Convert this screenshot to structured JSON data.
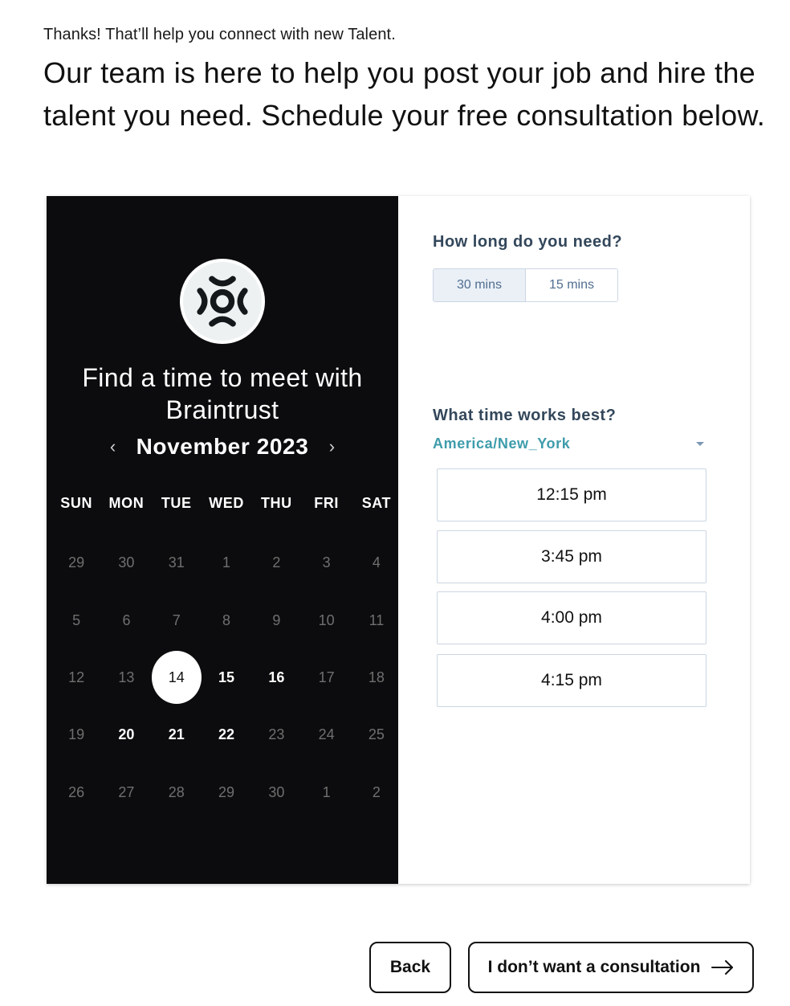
{
  "intro": {
    "small": "Thanks! That’ll help you connect with new Talent.",
    "large": "Our team is here to help you post your job and hire the talent you need. Schedule your free consultation below."
  },
  "calendar": {
    "title": "Find a time to meet with Braintrust",
    "month": "November 2023",
    "prev_icon": "chevron-left-icon",
    "next_icon": "chevron-right-icon",
    "weekdays": [
      "SUN",
      "MON",
      "TUE",
      "WED",
      "THU",
      "FRI",
      "SAT"
    ],
    "days": [
      {
        "label": "29",
        "state": "disabled"
      },
      {
        "label": "30",
        "state": "disabled"
      },
      {
        "label": "31",
        "state": "disabled"
      },
      {
        "label": "1",
        "state": "disabled"
      },
      {
        "label": "2",
        "state": "disabled"
      },
      {
        "label": "3",
        "state": "disabled"
      },
      {
        "label": "4",
        "state": "disabled"
      },
      {
        "label": "5",
        "state": "disabled"
      },
      {
        "label": "6",
        "state": "disabled"
      },
      {
        "label": "7",
        "state": "disabled"
      },
      {
        "label": "8",
        "state": "disabled"
      },
      {
        "label": "9",
        "state": "disabled"
      },
      {
        "label": "10",
        "state": "disabled"
      },
      {
        "label": "11",
        "state": "disabled"
      },
      {
        "label": "12",
        "state": "disabled"
      },
      {
        "label": "13",
        "state": "disabled"
      },
      {
        "label": "14",
        "state": "selected"
      },
      {
        "label": "15",
        "state": "available"
      },
      {
        "label": "16",
        "state": "available"
      },
      {
        "label": "17",
        "state": "disabled"
      },
      {
        "label": "18",
        "state": "disabled"
      },
      {
        "label": "19",
        "state": "disabled"
      },
      {
        "label": "20",
        "state": "available"
      },
      {
        "label": "21",
        "state": "available"
      },
      {
        "label": "22",
        "state": "available"
      },
      {
        "label": "23",
        "state": "disabled"
      },
      {
        "label": "24",
        "state": "disabled"
      },
      {
        "label": "25",
        "state": "disabled"
      },
      {
        "label": "26",
        "state": "disabled"
      },
      {
        "label": "27",
        "state": "disabled"
      },
      {
        "label": "28",
        "state": "disabled"
      },
      {
        "label": "29",
        "state": "disabled"
      },
      {
        "label": "30",
        "state": "disabled"
      },
      {
        "label": "1",
        "state": "disabled"
      },
      {
        "label": "2",
        "state": "disabled"
      }
    ]
  },
  "duration": {
    "label": "How long do you need?",
    "options": [
      "30 mins",
      "15 mins"
    ],
    "selected": "30 mins"
  },
  "times": {
    "label": "What time works best?",
    "timezone": "America/New_York",
    "slots": [
      "12:15 pm",
      "3:45 pm",
      "4:00 pm",
      "4:15 pm"
    ]
  },
  "actions": {
    "back_label": "Back",
    "skip_label": "I don’t want a consultation",
    "skip_icon": "arrow-right-icon"
  },
  "colors": {
    "calendar_bg": "#0c0c0e",
    "heading": "#33475b",
    "timezone": "#3e9cab",
    "border": "#cbd6e2"
  }
}
